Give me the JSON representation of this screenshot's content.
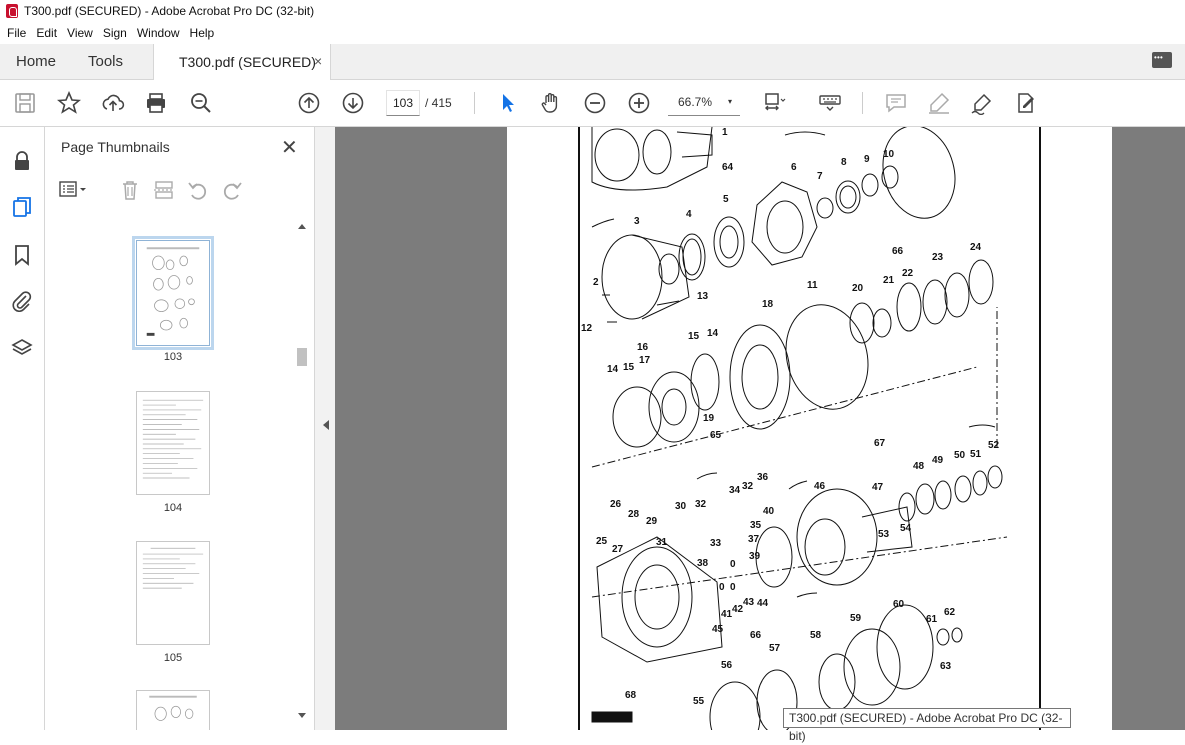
{
  "window": {
    "title": "T300.pdf (SECURED) - Adobe Acrobat Pro DC (32-bit)"
  },
  "menu": [
    "File",
    "Edit",
    "View",
    "Sign",
    "Window",
    "Help"
  ],
  "tabs": {
    "home": "Home",
    "tools": "Tools",
    "document": "T300.pdf (SECURED)",
    "close": "×"
  },
  "toolbar": {
    "current_page": "103",
    "total_pages": "/ 415",
    "zoom": "66.7%",
    "zoom_caret": "▾"
  },
  "thumbnails_panel": {
    "title": "Page Thumbnails",
    "close": "✕",
    "pages": [
      "103",
      "104",
      "105"
    ]
  },
  "callouts": [
    "1",
    "2",
    "3",
    "4",
    "5",
    "6",
    "7",
    "8",
    "9",
    "10",
    "11",
    "12",
    "13",
    "14",
    "15",
    "14",
    "15",
    "16",
    "17",
    "18",
    "19",
    "20",
    "21",
    "22",
    "23",
    "24",
    "25",
    "26",
    "27",
    "28",
    "29",
    "30",
    "31",
    "32",
    "33",
    "34",
    "32",
    "36",
    "35",
    "37",
    "38",
    "39",
    "40",
    "41",
    "42",
    "43",
    "44",
    "45",
    "46",
    "47",
    "48",
    "49",
    "50",
    "51",
    "52",
    "53",
    "54",
    "55",
    "56",
    "57",
    "58",
    "59",
    "60",
    "61",
    "62",
    "63",
    "64",
    "65",
    "66",
    "66",
    "67",
    "68",
    "0",
    "0",
    "0"
  ],
  "tooltip": "T300.pdf (SECURED) - Adobe Acrobat Pro DC (32-bit)",
  "colors": {
    "accent": "#1473e6",
    "app_red": "#c8102e",
    "doc_bg": "#7c7c7c"
  }
}
